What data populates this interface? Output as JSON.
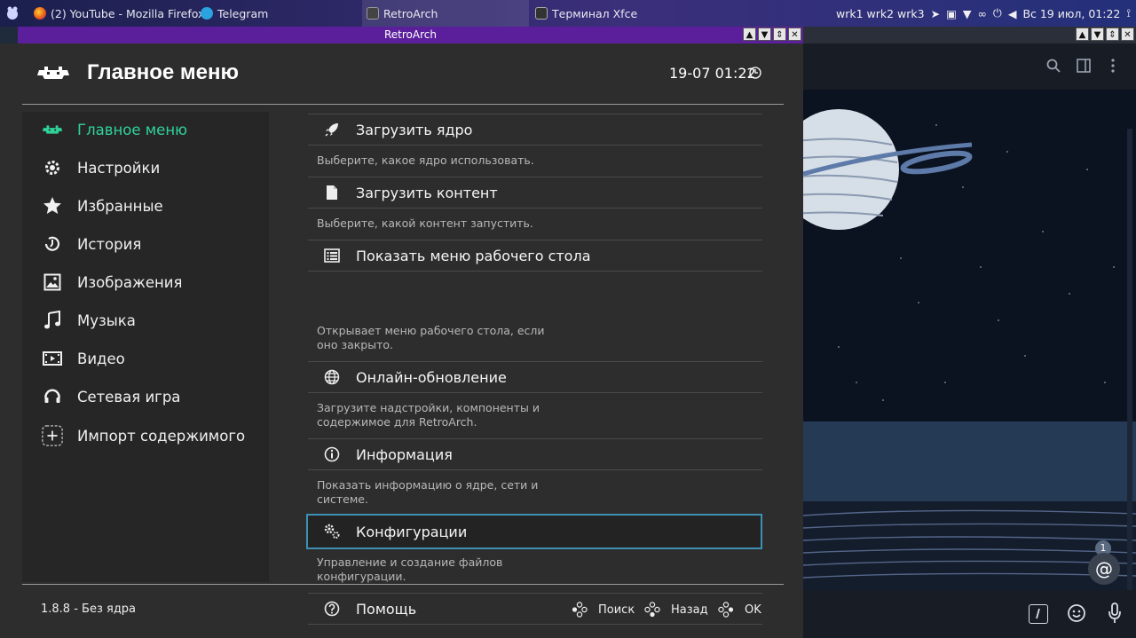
{
  "taskbar": {
    "firefox_label": "(2) YouTube - Mozilla Firefox",
    "telegram_label": "Telegram",
    "retroarch_label": "RetroArch",
    "terminal_label": "Терминал Xfce",
    "workspaces": "wrk1 wrk2 wrk3",
    "datetime": "Вс 19 июл, 01:22"
  },
  "window": {
    "title": "RetroArch"
  },
  "header": {
    "title": "Главное меню",
    "clock": "19-07 01:22"
  },
  "sidebar": {
    "items": [
      {
        "label": "Главное меню",
        "icon": "retroarch-invader-icon"
      },
      {
        "label": "Настройки",
        "icon": "gear-icon"
      },
      {
        "label": "Избранные",
        "icon": "star-icon"
      },
      {
        "label": "История",
        "icon": "history-icon"
      },
      {
        "label": "Изображения",
        "icon": "image-icon"
      },
      {
        "label": "Музыка",
        "icon": "music-icon"
      },
      {
        "label": "Видео",
        "icon": "video-icon"
      },
      {
        "label": "Сетевая игра",
        "icon": "netplay-icon"
      },
      {
        "label": "Импорт содержимого",
        "icon": "add-icon"
      }
    ]
  },
  "menu": {
    "items": [
      {
        "label": "Загрузить ядро",
        "desc1": "Выберите, какое ядро использовать.",
        "desc2": "",
        "icon": "rocket-icon"
      },
      {
        "label": "Загрузить контент",
        "desc1": "Выберите, какой контент запустить.",
        "desc2": "",
        "icon": "file-icon"
      },
      {
        "label": "Показать меню рабочего стола",
        "desc1": "Открывает меню рабочего стола, если",
        "desc2": "оно закрыто.",
        "icon": "desktop-menu-icon"
      },
      {
        "label": "Онлайн-обновление",
        "desc1": "Загрузите надстройки, компоненты и",
        "desc2": "содержимое для RetroArch.",
        "icon": "globe-icon"
      },
      {
        "label": "Информация",
        "desc1": "Показать информацию о ядре, сети и",
        "desc2": "системе.",
        "icon": "info-icon"
      },
      {
        "label": "Конфигурации",
        "desc1": "Управление и создание файлов",
        "desc2": "конфигурации.",
        "icon": "configs-gear-icon"
      },
      {
        "label": "Помощь",
        "desc1": "",
        "desc2": "",
        "icon": "help-icon"
      }
    ]
  },
  "footer": {
    "version": "1.8.8 - Без ядра",
    "search": "Поиск",
    "back": "Назад",
    "ok": "OK"
  },
  "telegram": {
    "badge_count": "1",
    "mention_symbol": "@"
  },
  "colors": {
    "accent": "#2fd39a",
    "selection": "#3d8fb3",
    "titlebar": "#5b1f9c"
  }
}
